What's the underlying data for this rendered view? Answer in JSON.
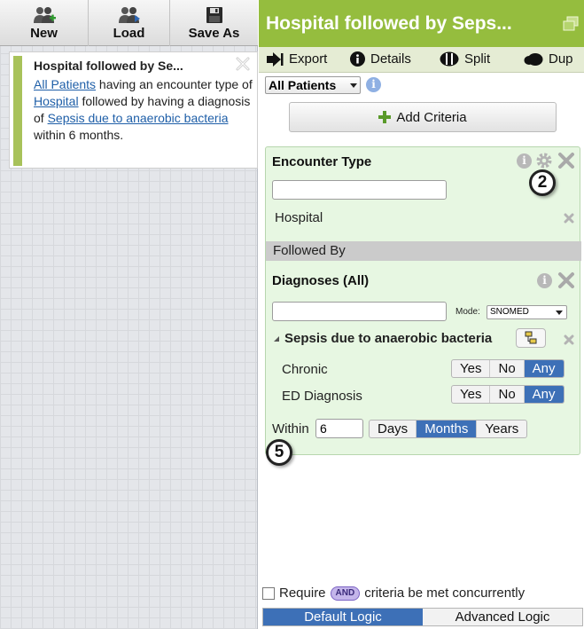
{
  "toolbar": {
    "new_label": "New",
    "load_label": "Load",
    "save_as_label": "Save As"
  },
  "query_card": {
    "title": "Hospital followed by Se...",
    "desc": {
      "link1": "All Patients",
      "text1": " having an encounter type of ",
      "link2": "Hospital",
      "text2": " followed by having a diagnosis of ",
      "link3": "Sepsis due to anaerobic bacteria",
      "text3": " within 6 months."
    }
  },
  "header": {
    "title": "Hospital followed by Seps..."
  },
  "actions": {
    "export": "Export",
    "details": "Details",
    "split": "Split",
    "dup": "Dup"
  },
  "population": {
    "selected": "All Patients"
  },
  "add_criteria_label": "Add Criteria",
  "encounter": {
    "title": "Encounter Type",
    "search_value": "",
    "item": "Hospital"
  },
  "followed_by_label": "Followed By",
  "diagnoses": {
    "title": "Diagnoses (All)",
    "search_value": "",
    "mode_label": "Mode:",
    "mode_value": "SNOMED",
    "item": "Sepsis due to anaerobic bacteria",
    "chronic_label": "Chronic",
    "ed_label": "ED Diagnosis",
    "options": {
      "yes": "Yes",
      "no": "No",
      "any": "Any"
    },
    "chronic_selected": "Any",
    "ed_selected": "Any"
  },
  "within": {
    "label": "Within",
    "value": "6",
    "units": {
      "days": "Days",
      "months": "Months",
      "years": "Years"
    },
    "selected": "Months"
  },
  "callouts": {
    "gear": "2",
    "within": "5"
  },
  "footer": {
    "require_pre": "Require",
    "and_pill": "AND",
    "require_post": "criteria be met concurrently",
    "default_logic": "Default Logic",
    "advanced_logic": "Advanced Logic",
    "selected": "Default Logic"
  },
  "colors": {
    "header_green": "#95bd3e",
    "accent_blue": "#3d70b7",
    "criteria_bg": "#e7f7e2",
    "link_blue": "#1f5fa8"
  },
  "icons": [
    "users-add-icon",
    "users-load-icon",
    "floppy-disk-icon",
    "export-arrow-icon",
    "info-icon",
    "split-icon",
    "duplicate-icon",
    "gear-icon",
    "close-icon",
    "plus-icon",
    "hierarchy-icon"
  ]
}
